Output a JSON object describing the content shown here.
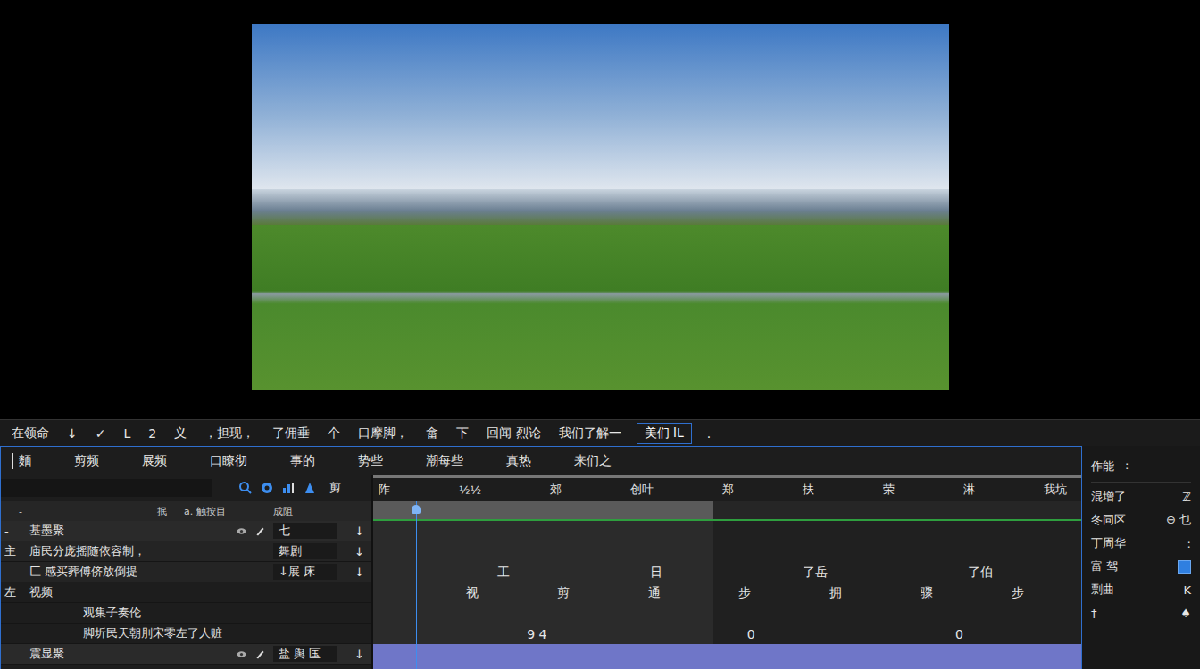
{
  "toolbar": {
    "items": [
      {
        "label": "在领命",
        "selected": false
      },
      {
        "label": "↓",
        "selected": false
      },
      {
        "label": "✓",
        "selected": false
      },
      {
        "label": "L",
        "selected": false
      },
      {
        "label": "2",
        "selected": false
      },
      {
        "label": "义",
        "selected": false
      },
      {
        "label": "，担现，",
        "selected": false
      },
      {
        "label": "了佣垂",
        "selected": false
      },
      {
        "label": "个",
        "selected": false
      },
      {
        "label": "口摩脚，",
        "selected": false
      },
      {
        "label": "畲",
        "selected": false
      },
      {
        "label": "下",
        "selected": false
      },
      {
        "label": "回闻 烈论",
        "selected": false
      },
      {
        "label": "我们了解一",
        "selected": false
      },
      {
        "label": "美们 lL",
        "selected": true
      },
      {
        "label": ".",
        "selected": false
      }
    ]
  },
  "tabs": [
    {
      "label": "麵",
      "selected": true
    },
    {
      "label": "剪频",
      "selected": false
    },
    {
      "label": "展频",
      "selected": false
    },
    {
      "label": "口瞭彻",
      "selected": false
    },
    {
      "label": "事的",
      "selected": false
    },
    {
      "label": "势些",
      "selected": false
    },
    {
      "label": "潮每些",
      "selected": false
    },
    {
      "label": "真热",
      "selected": false
    },
    {
      "label": "来们之",
      "selected": false
    }
  ],
  "left_panel": {
    "search_label": "剪",
    "header": [
      "-",
      "抿",
      "a. 触按目",
      "成阻"
    ],
    "rows": [
      {
        "kind": "track",
        "prefix": "-",
        "label": "基墨聚",
        "value": "七",
        "menu": "↓"
      },
      {
        "kind": "field",
        "prefix": "主",
        "label": "庙民分庞摇随依容制，",
        "value": "舞剧",
        "menu": "↓"
      },
      {
        "kind": "field",
        "prefix": "",
        "label": "匚 感买葬傅侪放倒提",
        "value": "↓展  床",
        "menu": "↓"
      },
      {
        "kind": "group",
        "prefix": "左",
        "label": "视频"
      },
      {
        "kind": "item",
        "prefix": "",
        "label": "观集子奏伦"
      },
      {
        "kind": "item",
        "prefix": "",
        "label": "脚圻民天朝刖宋零左了人赃"
      },
      {
        "kind": "track",
        "prefix": "",
        "label": "震显聚",
        "value": "盐  舆  匤",
        "menu": "↓"
      }
    ]
  },
  "timeline": {
    "ruler": [
      "阼",
      "½½",
      "郊",
      "创叶",
      "郑",
      "扶",
      "荣",
      "淋",
      "我坑"
    ],
    "work_area": {
      "level": 0.48
    },
    "playhead": {
      "level": 0.06
    },
    "rows": [
      {
        "kind": "empty",
        "cells": []
      },
      {
        "kind": "empty",
        "cells": []
      },
      {
        "kind": "labels",
        "cells": [
          "工",
          "日",
          "了岳",
          "了伯"
        ]
      },
      {
        "kind": "labels",
        "cells": [
          "视",
          "剪",
          "通",
          "步",
          "拥",
          "骤",
          "步"
        ]
      },
      {
        "kind": "empty",
        "cells": []
      },
      {
        "kind": "labels",
        "cells": [
          "9 4",
          "0",
          "0"
        ]
      },
      {
        "kind": "clip",
        "cells": []
      }
    ]
  },
  "right_panel": {
    "title": "作能",
    "title_mark": ":",
    "rows": [
      {
        "kind": "value",
        "label": "混增了",
        "value": "ℤ"
      },
      {
        "kind": "value",
        "label": "冬同区",
        "value": "⊖  乜"
      },
      {
        "kind": "value",
        "label": "丁周华",
        "value": ":"
      },
      {
        "kind": "checkbox",
        "label": "富 驾",
        "checked": true
      },
      {
        "kind": "value",
        "label": "剽曲",
        "value": "K"
      },
      {
        "kind": "value",
        "label": "‡",
        "value": "♠"
      }
    ]
  }
}
